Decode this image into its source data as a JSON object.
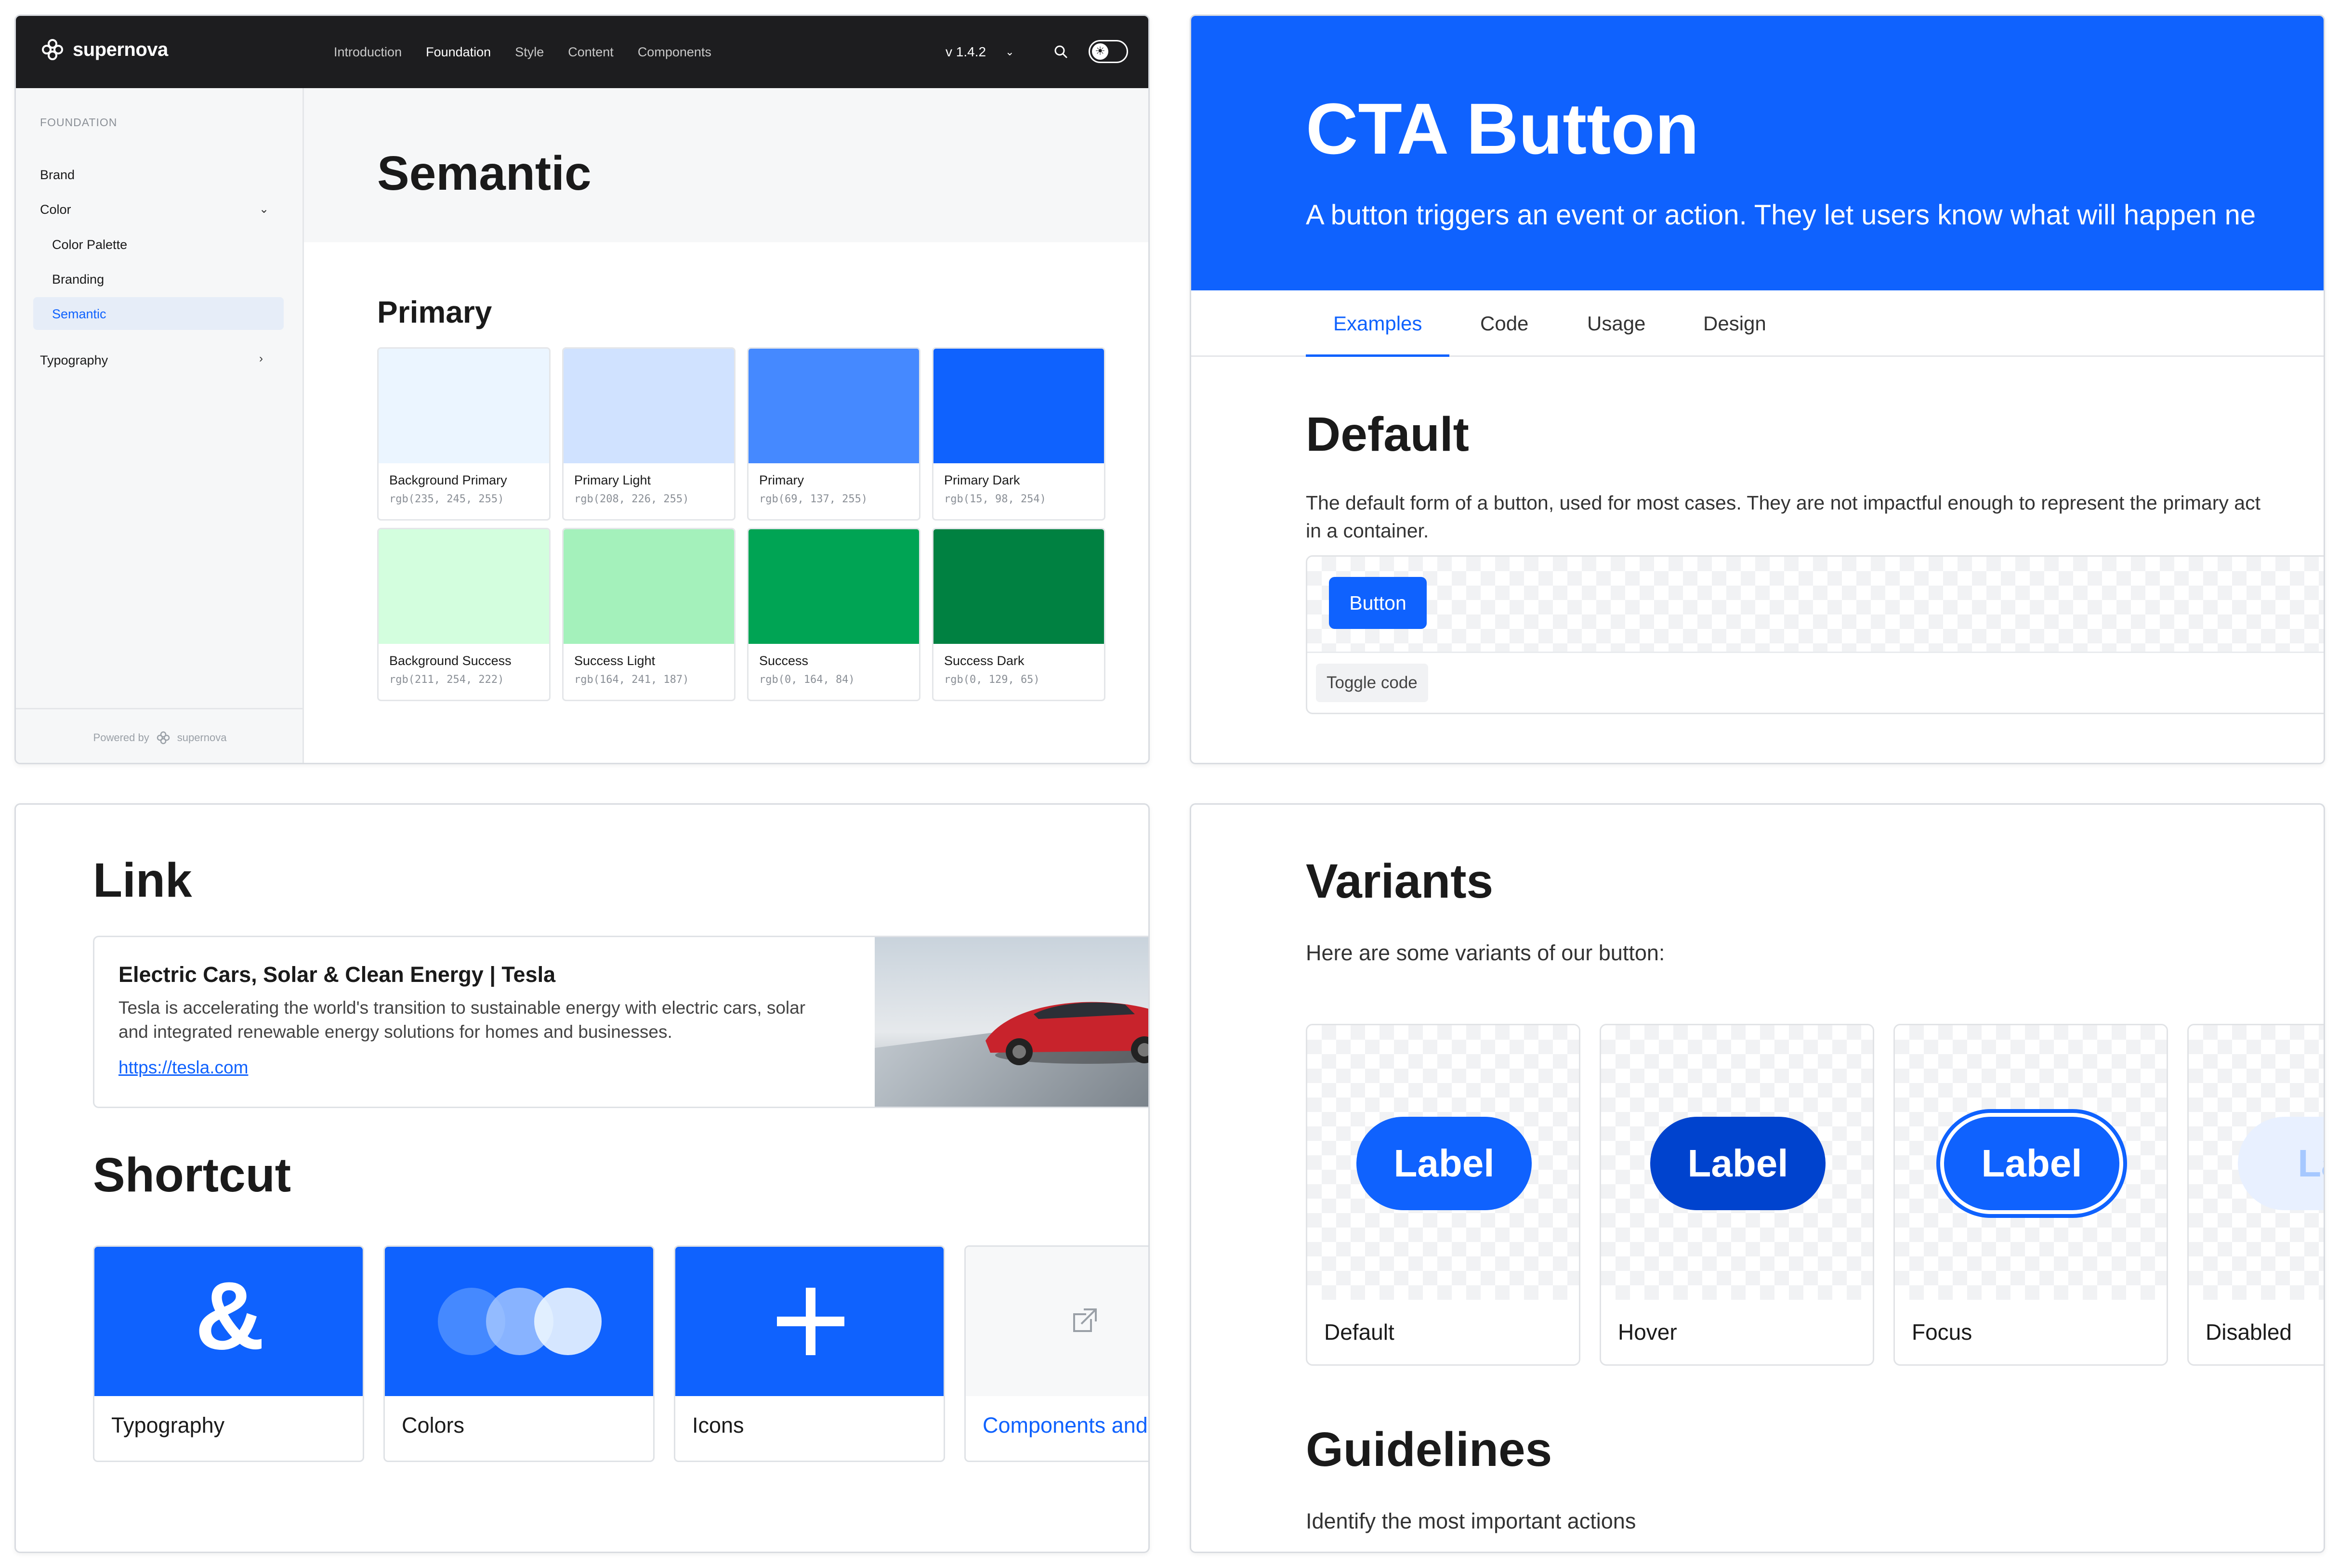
{
  "docs_site": {
    "brand": "supernova",
    "nav": [
      "Introduction",
      "Foundation",
      "Style",
      "Content",
      "Components"
    ],
    "version": "v 1.4.2",
    "sidebar": {
      "section": "FOUNDATION",
      "items": [
        "Brand",
        "Color",
        "Typography"
      ],
      "color_children": [
        "Color Palette",
        "Branding",
        "Semantic"
      ],
      "active": "Semantic",
      "powered_by": "Powered by",
      "powered_brand": "supernova"
    },
    "page_title": "Semantic",
    "section_title": "Primary",
    "swatches": [
      {
        "name": "Background Primary",
        "value": "rgb(235, 245, 255)",
        "color": "#ebf5ff"
      },
      {
        "name": "Primary Light",
        "value": "rgb(208, 226, 255)",
        "color": "#d0e2ff"
      },
      {
        "name": "Primary",
        "value": "rgb(69, 137, 255)",
        "color": "#4589ff"
      },
      {
        "name": "Primary Dark",
        "value": "rgb(15, 98, 254)",
        "color": "#0f62fe"
      },
      {
        "name": "Background Success",
        "value": "rgb(211, 254, 222)",
        "color": "#d3fede"
      },
      {
        "name": "Success Light",
        "value": "rgb(164, 241, 187)",
        "color": "#a4f1bb"
      },
      {
        "name": "Success",
        "value": "rgb(0, 164, 84)",
        "color": "#00a454"
      },
      {
        "name": "Success Dark",
        "value": "rgb(0, 129, 65)",
        "color": "#008141"
      }
    ]
  },
  "cta_page": {
    "title": "CTA Button",
    "subtitle": "A button triggers an event or action. They let users know what will happen ne",
    "tabs": [
      "Examples",
      "Code",
      "Usage",
      "Design"
    ],
    "active_tab": "Examples",
    "default_heading": "Default",
    "default_desc_line1": "The default form of a button, used for most cases. They are not impactful enough to represent the primary act",
    "default_desc_line2": "in a container.",
    "demo_button": "Button",
    "toggle_code": "Toggle code"
  },
  "link_page": {
    "link_heading": "Link",
    "card": {
      "title": "Electric Cars, Solar & Clean Energy | Tesla",
      "description": "Tesla is accelerating the world's transition to sustainable energy with electric cars, solar and integrated renewable energy solutions for homes and businesses.",
      "url": "https://tesla.com"
    },
    "shortcut_heading": "Shortcut",
    "shortcuts": [
      {
        "label": "Typography",
        "icon": "ampersand-icon"
      },
      {
        "label": "Colors",
        "icon": "color-circles-icon"
      },
      {
        "label": "Icons",
        "icon": "plus-icon"
      },
      {
        "label": "Components and",
        "icon": "external-link-icon"
      }
    ]
  },
  "variants_page": {
    "heading": "Variants",
    "intro": "Here are some variants of our button:",
    "variants": [
      {
        "name": "Default",
        "label": "Label",
        "color": "#0f62fe"
      },
      {
        "name": "Hover",
        "label": "Label",
        "color": "#0043ce"
      },
      {
        "name": "Focus",
        "label": "Label",
        "color": "#0f62fe"
      },
      {
        "name": "Disabled",
        "label": "Lal",
        "color": "#e8f0ff"
      }
    ],
    "guidelines_heading": "Guidelines",
    "guidelines_text": "Identify the most important actions"
  }
}
